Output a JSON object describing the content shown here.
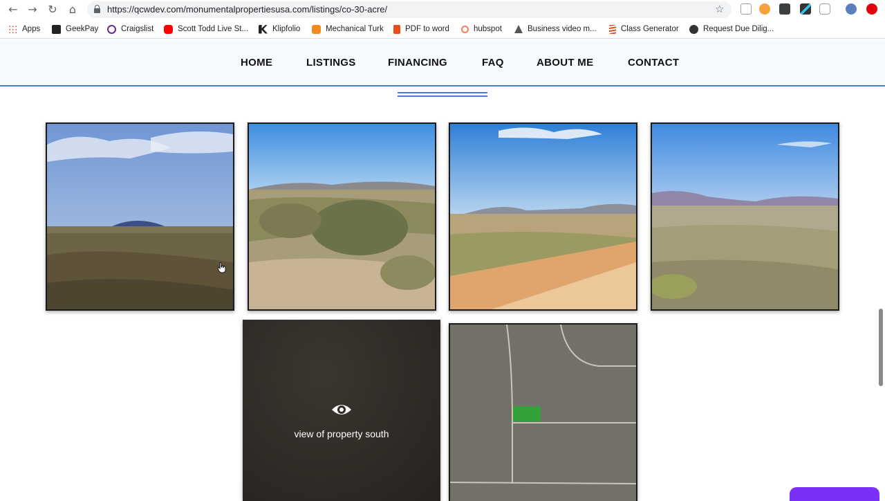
{
  "browser": {
    "url": "https://qcwdev.com/monumentalpropertiesusa.com/listings/co-30-acre/",
    "bookmarks": [
      {
        "label": "Apps",
        "icon": "apps-grid-icon",
        "color": "#e8453c"
      },
      {
        "label": "GeekPay",
        "icon": "geekpay-icon",
        "color": "#222222"
      },
      {
        "label": "Craigslist",
        "icon": "peace-icon",
        "color": "#6b2a91"
      },
      {
        "label": "Scott Todd Live St...",
        "icon": "youtube-icon",
        "color": "#ff0000"
      },
      {
        "label": "Klipfolio",
        "icon": "klipfolio-icon",
        "color": "#222222"
      },
      {
        "label": "Mechanical Turk",
        "icon": "mturk-icon",
        "color": "#f28a1e"
      },
      {
        "label": "PDF to word",
        "icon": "pdf-icon",
        "color": "#ea4c1c"
      },
      {
        "label": "hubspot",
        "icon": "hubspot-icon",
        "color": "#ff7a59"
      },
      {
        "label": "Business video m...",
        "icon": "video-icon",
        "color": "#555555"
      },
      {
        "label": "Class Generator",
        "icon": "class-generator-icon",
        "color": "#e24a2d"
      },
      {
        "label": "Request Due Dilig...",
        "icon": "globe-icon",
        "color": "#333333"
      }
    ]
  },
  "site_nav": {
    "items": [
      "HOME",
      "LISTINGS",
      "FINANCING",
      "FAQ",
      "ABOUT ME",
      "CONTACT"
    ]
  },
  "gallery": {
    "hover_caption": "view of property south"
  },
  "colors": {
    "accent": "#4a78d8",
    "chat_tab": "#7b2ff7",
    "parcel_marker": "#33a23a"
  }
}
